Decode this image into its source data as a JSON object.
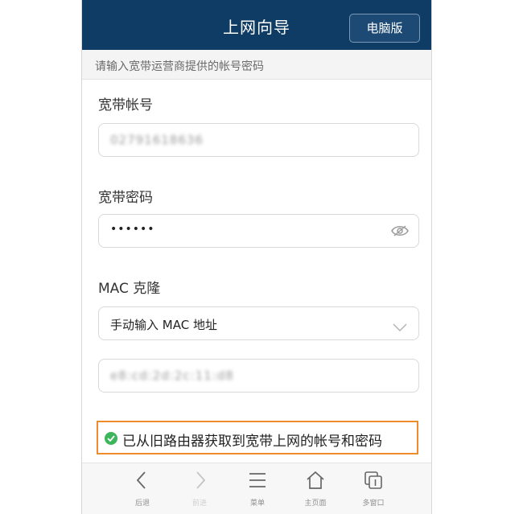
{
  "header": {
    "title": "上网向导",
    "pc_version_label": "电脑版"
  },
  "hint": "请输入宽带运营商提供的帐号密码",
  "account": {
    "label": "宽带帐号",
    "value": "02791618636"
  },
  "password": {
    "label": "宽带密码",
    "value": "••••••"
  },
  "mac": {
    "label": "MAC 克隆",
    "select_value": "手动输入 MAC 地址",
    "address": "e8:cd:2d:2c:11:d8"
  },
  "success_message": "已从旧路由器获取到宽带上网的帐号和密码",
  "bottom_nav": [
    {
      "label": "后退",
      "icon": "back-icon"
    },
    {
      "label": "前进",
      "icon": "forward-icon"
    },
    {
      "label": "菜单",
      "icon": "menu-icon"
    },
    {
      "label": "主页面",
      "icon": "home-icon"
    },
    {
      "label": "多窗口",
      "icon": "windows-icon"
    }
  ],
  "colors": {
    "header_bg": "#0e3c64",
    "success_border": "#ef8a2e",
    "success_check": "#3cb55b"
  }
}
